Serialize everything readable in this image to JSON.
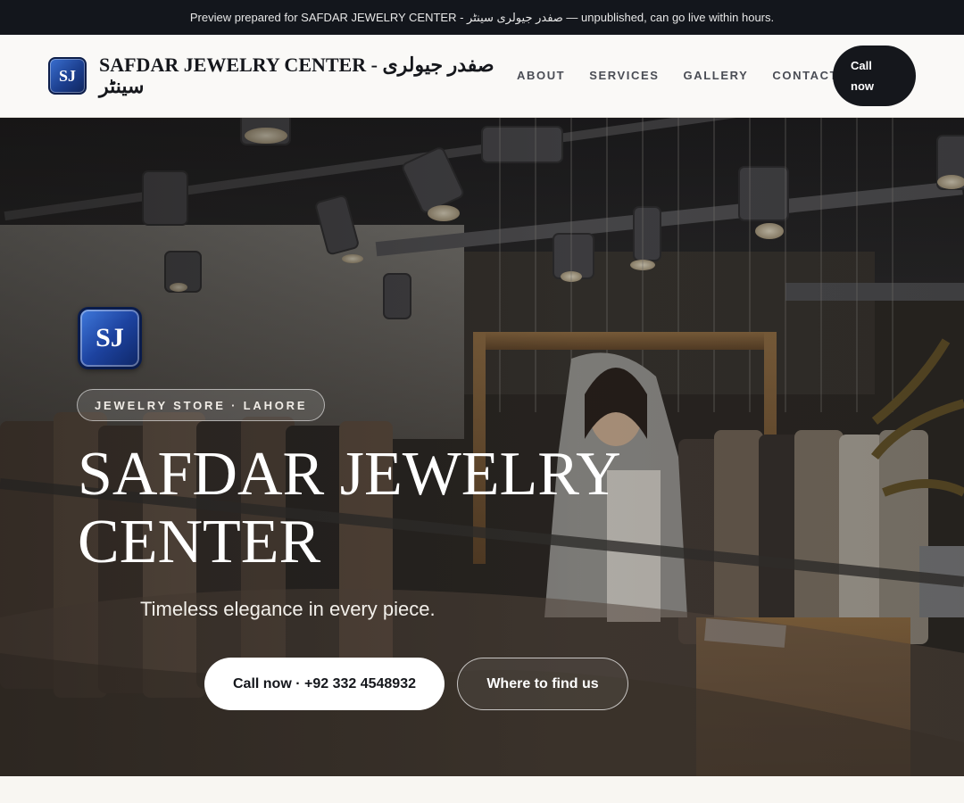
{
  "preview_banner": {
    "text": "Preview prepared for SAFDAR JEWELRY CENTER - صفدر جیولری سینٹر — unpublished, can go live within hours."
  },
  "header": {
    "logo_initials": "SJ",
    "brand_name": "SAFDAR JEWELRY CENTER - صفدر جیولری سینٹر",
    "nav": [
      {
        "label": "ABOUT"
      },
      {
        "label": "SERVICES"
      },
      {
        "label": "GALLERY"
      },
      {
        "label": "CONTACT"
      }
    ],
    "call_button": "Call now"
  },
  "hero": {
    "logo_initials": "SJ",
    "badge": "JEWELRY STORE · LAHORE",
    "title": "SAFDAR JEWELRY CENTER",
    "subtitle": "Timeless elegance in every piece.",
    "primary_cta": "Call now · +92 332 4548932",
    "secondary_cta": "Where to find us"
  },
  "colors": {
    "dark": "#13161c",
    "logo_blue": "#1c3f8f",
    "page_bg": "#f7f5f1"
  }
}
